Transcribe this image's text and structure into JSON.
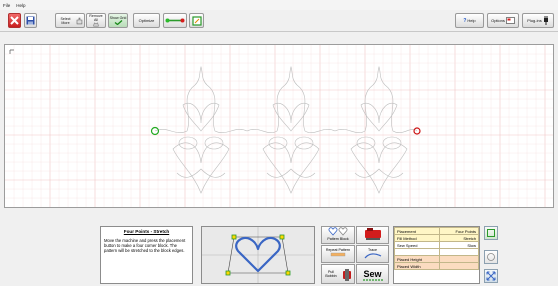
{
  "menu": [
    "File",
    "Help"
  ],
  "toolbar": {
    "select_more": "Select More",
    "remove_all": "Remove All",
    "show_grid": "Show Grid",
    "optimize": "Optimize",
    "help": "Help",
    "options": "Options",
    "plugins": "Plug-ins"
  },
  "canvas": {
    "start_color": "#22aa22",
    "end_color": "#cc1111"
  },
  "instructions": {
    "title": "Four Points - Stretch",
    "body": "Move the machine and press the placement button to make a four corner block. The pattern will be stretched to the block edges."
  },
  "buttons": {
    "pattern_block": "Pattern Block",
    "repeat_pattern": "Repeat Pattern",
    "trace": "Trace",
    "pull_bobbin": "Pull Bobbin",
    "sew": "Sew"
  },
  "properties": {
    "rows": [
      {
        "label": "Placement",
        "value": "Four Points",
        "style": "yl"
      },
      {
        "label": "Fill Method",
        "value": "Stretch",
        "style": "yl"
      },
      {
        "label": "Sew Speed",
        "value": "Slow",
        "style": ""
      },
      {
        "label": "",
        "value": "",
        "style": ""
      },
      {
        "label": "Placed Height",
        "value": "",
        "style": "hl"
      },
      {
        "label": "Placed Width",
        "value": "",
        "style": "hl"
      }
    ]
  }
}
